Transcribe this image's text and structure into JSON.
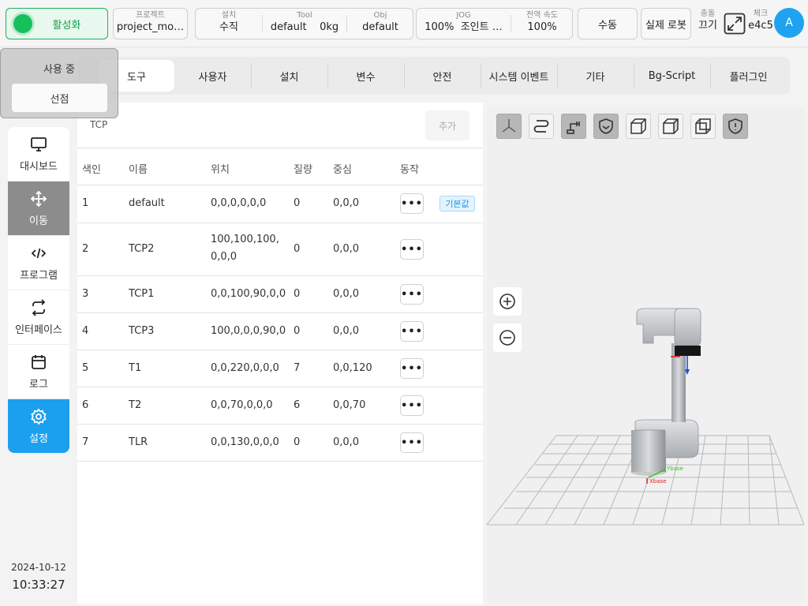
{
  "topbar": {
    "activate_label": "활성화",
    "project": {
      "key": "프로젝트",
      "value": "project_mo…"
    },
    "install": {
      "key": "설치",
      "value": "수직"
    },
    "tool": {
      "key": "Tool",
      "value": "default",
      "mass": "0kg"
    },
    "obj": {
      "key": "Obj",
      "value": "default"
    },
    "jog": {
      "key": "JOG",
      "percent": "100%",
      "mode": "조인트 …"
    },
    "global_speed": {
      "key": "전역 속도",
      "value": "100%"
    },
    "manual_label": "수동",
    "real_robot_label": "실제 로봇",
    "collision": {
      "key": "충돌",
      "value": "끄기"
    },
    "check": {
      "key": "체크",
      "value": "e4c5"
    },
    "avatar_letter": "A"
  },
  "dropdown": {
    "status": "사용 중",
    "select_label": "선점"
  },
  "tabs": [
    "도구",
    "사용자",
    "설치",
    "변수",
    "안전",
    "시스템 이벤트",
    "기타",
    "Bg-Script",
    "플러그인"
  ],
  "sidebar": {
    "items": [
      {
        "label": "대시보드",
        "icon": "monitor-icon"
      },
      {
        "label": "이동",
        "icon": "move-arrows-icon"
      },
      {
        "label": "프로그램",
        "icon": "code-icon"
      },
      {
        "label": "인터페이스",
        "icon": "swap-icon"
      },
      {
        "label": "로그",
        "icon": "calendar-icon"
      },
      {
        "label": "설정",
        "icon": "gear-icon"
      }
    ],
    "date": "2024-10-12",
    "time": "10:33:27"
  },
  "tcp": {
    "title": "TCP",
    "add_label": "추가",
    "columns": [
      "색인",
      "이름",
      "위치",
      "질량",
      "중심",
      "동작"
    ],
    "default_badge": "기본값",
    "rows": [
      {
        "index": "1",
        "name": "default",
        "pos": "0,0,0,0,0,0",
        "mass": "0",
        "center": "0,0,0",
        "default": true
      },
      {
        "index": "2",
        "name": "TCP2",
        "pos": "100,100,100,0,0,0",
        "mass": "0",
        "center": "0,0,0"
      },
      {
        "index": "3",
        "name": "TCP1",
        "pos": "0,0,100,90,0,0",
        "mass": "0",
        "center": "0,0,0"
      },
      {
        "index": "4",
        "name": "TCP3",
        "pos": "100,0,0,0,90,0",
        "mass": "0",
        "center": "0,0,0"
      },
      {
        "index": "5",
        "name": "T1",
        "pos": "0,0,220,0,0,0",
        "mass": "7",
        "center": "0,0,120"
      },
      {
        "index": "6",
        "name": "T2",
        "pos": "0,0,70,0,0,0",
        "mass": "6",
        "center": "0,0,70"
      },
      {
        "index": "7",
        "name": "TLR",
        "pos": "0,0,130,0,0,0",
        "mass": "0",
        "center": "0,0,0"
      }
    ]
  },
  "colors": {
    "accent_green": "#17c05b",
    "accent_blue": "#1aa0ee",
    "selected_gray": "#8c8c8c"
  }
}
